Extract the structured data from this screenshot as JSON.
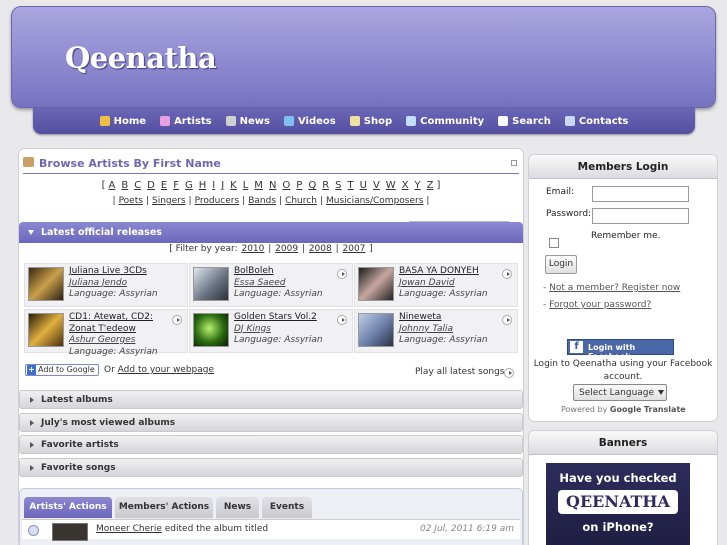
{
  "site": {
    "logo_text": "Qeenatha"
  },
  "nav": [
    {
      "label": "Home",
      "icon": "home-icon"
    },
    {
      "label": "Artists",
      "icon": "artists-icon"
    },
    {
      "label": "News",
      "icon": "news-icon"
    },
    {
      "label": "Videos",
      "icon": "videos-icon"
    },
    {
      "label": "Shop",
      "icon": "shop-icon"
    },
    {
      "label": "Community",
      "icon": "community-icon"
    },
    {
      "label": "Search",
      "icon": "search-icon"
    },
    {
      "label": "Contacts",
      "icon": "contacts-icon"
    }
  ],
  "browse": {
    "title": "Browse Artists By First Name",
    "letters": [
      "A",
      "B",
      "C",
      "D",
      "E",
      "F",
      "G",
      "H",
      "I",
      "J",
      "K",
      "L",
      "M",
      "N",
      "O",
      "P",
      "Q",
      "R",
      "S",
      "T",
      "U",
      "V",
      "W",
      "X",
      "Y",
      "Z"
    ],
    "categories": [
      "Poets",
      "Singers",
      "Producers",
      "Bands",
      "Church",
      "Musicians/Composers"
    ]
  },
  "latest": {
    "title": "Latest official releases",
    "filter_label": "Filter by year:",
    "years": [
      "2010",
      "2009",
      "2008",
      "2007"
    ],
    "releases": [
      {
        "title": "Juliana Live 3CDs",
        "artist": "Juliana Jendo",
        "language": "Language: Assyrian"
      },
      {
        "title": "BolBoleh",
        "artist": "Essa Saeed",
        "language": "Language: Assyrian"
      },
      {
        "title": "BASA YA DONYEH",
        "artist": "Jowan David",
        "language": "Language: Assyrian"
      },
      {
        "title": "CD1: Atewat, CD2: Zonat T'edeow",
        "title_line1": "CD1: Atewat, CD2:",
        "title_line2": "Zonat T'edeow",
        "artist": "Ashur Georges",
        "language": "Language: Assyrian"
      },
      {
        "title": "Golden Stars Vol.2",
        "artist": "DJ Kings",
        "language": "Language: Assyrian"
      },
      {
        "title": "Nineweta",
        "artist": "Johnny Talia",
        "language": "Language: Assyrian"
      }
    ],
    "add_to_google": "Add to Google",
    "or_text": "Or",
    "add_webpage": "Add to your webpage",
    "play_all": "Play all latest songs"
  },
  "sections": [
    "Latest albums",
    "July's most viewed albums",
    "Favorite artists",
    "Favorite songs"
  ],
  "tabs": [
    "Artists' Actions",
    "Members' Actions",
    "News",
    "Events"
  ],
  "activity": {
    "user": "Moneer Cherie",
    "action": "edited the album titled",
    "time": "02 Jul, 2011 6:19 am"
  },
  "login": {
    "title": "Members Login",
    "email_label": "Email:",
    "password_label": "Password:",
    "remember_label": "Remember me.",
    "button": "Login",
    "register_link": "Not a member? Register now",
    "forgot_link": "Forgot your password?",
    "facebook_button": "Login with Facebook",
    "facebook_text": "Login to Qeenatha using your Facebook account.",
    "select_language": "Select Language",
    "powered_by": "Powered by",
    "google": "Google",
    "translate": "Translate"
  },
  "banners": {
    "title": "Banners",
    "line1": "Have you checked",
    "logo": "QEENATHA",
    "line2": "on iPhone?"
  }
}
